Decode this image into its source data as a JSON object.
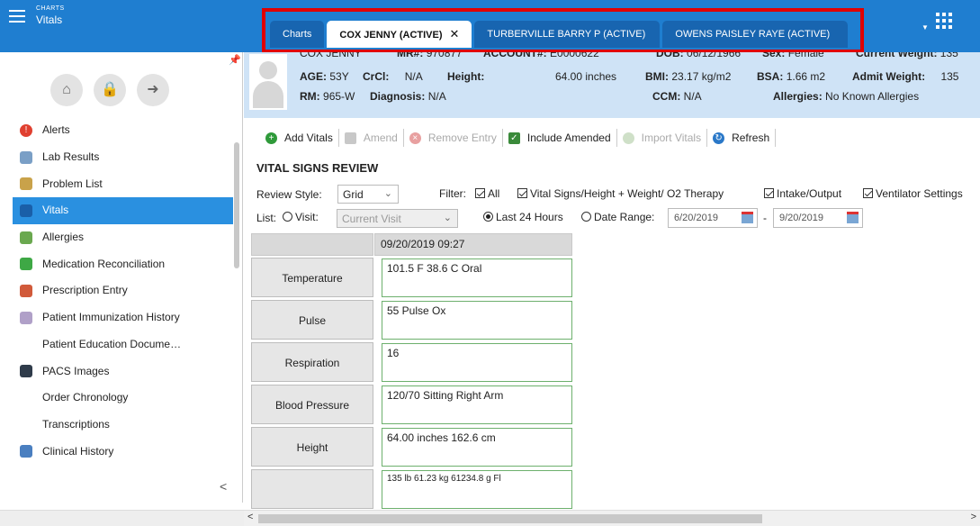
{
  "app": {
    "section": "CHARTS",
    "title": "Vitals"
  },
  "tabs": [
    {
      "label": "Charts"
    },
    {
      "label": "COX JENNY (ACTIVE)",
      "close": "✕"
    },
    {
      "label": "TURBERVILLE BARRY P (ACTIVE)"
    },
    {
      "label": "OWENS PAISLEY RAYE (ACTIVE)"
    }
  ],
  "sidebar": {
    "items": [
      {
        "label": "Alerts",
        "icon": "alert-icon"
      },
      {
        "label": "Lab Results",
        "icon": "flask-icon"
      },
      {
        "label": "Problem List",
        "icon": "clipboard-icon"
      },
      {
        "label": "Vitals",
        "icon": "vitals-icon",
        "active": true
      },
      {
        "label": "Allergies",
        "icon": "allergy-icon"
      },
      {
        "label": "Medication Reconciliation",
        "icon": "medication-icon"
      },
      {
        "label": "Prescription Entry",
        "icon": "prescription-icon"
      },
      {
        "label": "Patient Immunization History",
        "icon": "syringe-icon"
      },
      {
        "label": "Patient Education Docume…"
      },
      {
        "label": "PACS Images",
        "icon": "pacs-icon"
      },
      {
        "label": "Order Chronology"
      },
      {
        "label": "Transcriptions"
      },
      {
        "label": "Clinical History",
        "icon": "document-icon"
      }
    ],
    "collapse": "<"
  },
  "patient": {
    "name": "COX JENNY",
    "mr_label": "MR#:",
    "mr": "970877",
    "account_label": "ACCOUNT#:",
    "account": "E0000622",
    "dob_label": "DOB:",
    "dob": "06/12/1966",
    "sex_label": "Sex:",
    "sex": "Female",
    "cw_label": "Current Weight:",
    "cw": "135",
    "age_label": "AGE:",
    "age": "53Y",
    "crcl_label": "CrCl:",
    "crcl": "N/A",
    "height_label": "Height:",
    "height": "64.00 inches",
    "bmi_label": "BMI:",
    "bmi": "23.17 kg/m2",
    "bsa_label": "BSA:",
    "bsa": "1.66 m2",
    "aw_label": "Admit Weight:",
    "aw": "135",
    "rm_label": "RM:",
    "rm": "965-W",
    "diag_label": "Diagnosis:",
    "diag": "N/A",
    "ccm_label": "CCM:",
    "ccm": "N/A",
    "allergies_label": "Allergies:",
    "allergies": "No Known Allergies"
  },
  "toolbar": {
    "add": "Add Vitals",
    "amend": "Amend",
    "remove": "Remove Entry",
    "include": "Include Amended",
    "import": "Import Vitals",
    "refresh": "Refresh"
  },
  "review": {
    "title": "VITAL SIGNS REVIEW",
    "style_label": "Review Style:",
    "style_value": "Grid",
    "filter_label": "Filter:",
    "filter_all": "All",
    "filter_vitals": "Vital Signs/Height + Weight/ O2 Therapy",
    "filter_io": "Intake/Output",
    "filter_vent": "Ventilator Settings",
    "list_label": "List:",
    "visit_label": "Visit:",
    "visit_value": "Current Visit",
    "last24": "Last 24 Hours",
    "date_range": "Date Range:",
    "date_from": "6/20/2019",
    "date_sep": "-",
    "date_to": "9/20/2019"
  },
  "grid": {
    "column_date": "09/20/2019 09:27",
    "rows": [
      {
        "label": "Temperature",
        "value": "101.5 F 38.6 C Oral"
      },
      {
        "label": "Pulse",
        "value": "55 Pulse Ox"
      },
      {
        "label": "Respiration",
        "value": "16"
      },
      {
        "label": "Blood Pressure",
        "value": "120/70 Sitting Right Arm"
      },
      {
        "label": "Height",
        "value": "64.00 inches 162.6 cm"
      },
      {
        "label": "",
        "value": "135 lb  61.23 kg  61234.8 g  Fl"
      }
    ]
  },
  "colors": {
    "header_blue": "#1f7ed0",
    "active_nav": "#2a90e0",
    "highlight": "#e00000",
    "patient_banner": "#cfe3f6"
  }
}
